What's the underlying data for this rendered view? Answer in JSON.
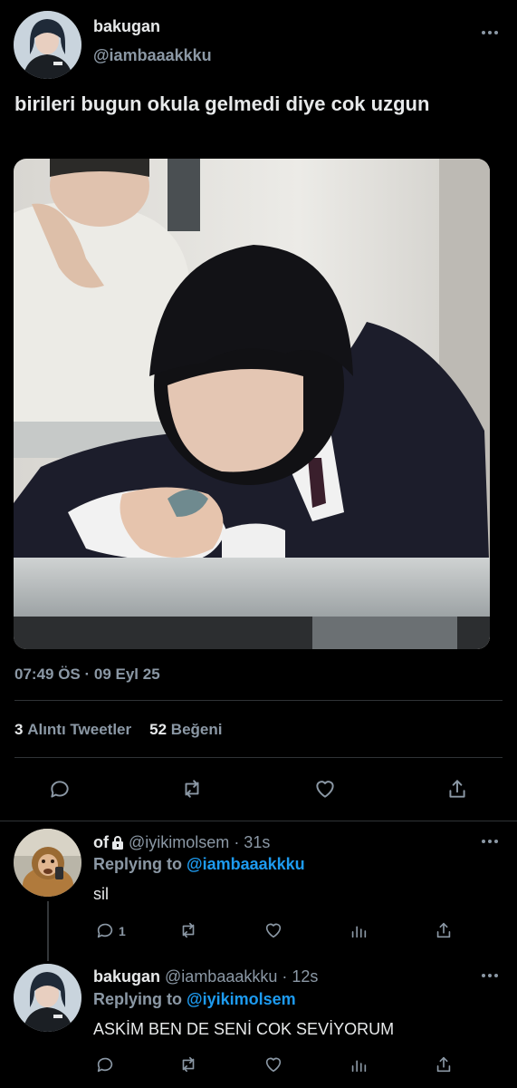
{
  "main_tweet": {
    "display_name": "bakugan",
    "handle": "@iambaaakkku",
    "text": "birileri bugun okula gelmedi diye cok uzgun",
    "timestamp": "07:49 ÖS · 09 Eyl 25",
    "stats": {
      "quote_count": "3",
      "quote_label": "Alıntı Tweetler",
      "like_count": "52",
      "like_label": "Beğeni"
    }
  },
  "replies": [
    {
      "display_name": "of",
      "handle": "@iyikimolsem",
      "time": "· 31s",
      "replying_prefix": "Replying to",
      "replying_to": "@iambaaakkku",
      "text": "sil",
      "reply_count": "1",
      "locked": true
    },
    {
      "display_name": "bakugan",
      "handle": "@iambaaakkku",
      "time": "· 12s",
      "replying_prefix": "Replying to",
      "replying_to": "@iyikimolsem",
      "text": "ASKİM BEN DE SENİ COK SEVİYORUM",
      "reply_count": ""
    }
  ],
  "icons": {
    "reply": "reply-icon",
    "retweet": "retweet-icon",
    "like": "heart-icon",
    "share": "share-icon",
    "analytics": "analytics-icon",
    "more": "more-icon",
    "lock": "lock-icon"
  },
  "colors": {
    "background": "#000000",
    "text": "#e7e9ea",
    "muted": "#8b98a5",
    "link": "#1d9bf0",
    "divider": "#2f3336"
  }
}
